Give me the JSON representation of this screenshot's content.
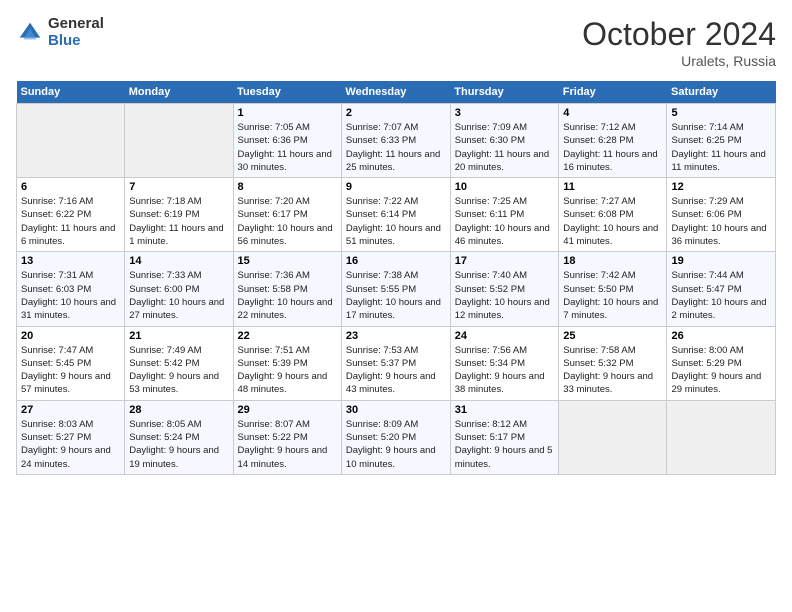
{
  "logo": {
    "general": "General",
    "blue": "Blue"
  },
  "title": "October 2024",
  "location": "Uralets, Russia",
  "days_of_week": [
    "Sunday",
    "Monday",
    "Tuesday",
    "Wednesday",
    "Thursday",
    "Friday",
    "Saturday"
  ],
  "weeks": [
    [
      {
        "day": "",
        "info": ""
      },
      {
        "day": "",
        "info": ""
      },
      {
        "day": "1",
        "info": "Sunrise: 7:05 AM\nSunset: 6:36 PM\nDaylight: 11 hours and 30 minutes."
      },
      {
        "day": "2",
        "info": "Sunrise: 7:07 AM\nSunset: 6:33 PM\nDaylight: 11 hours and 25 minutes."
      },
      {
        "day": "3",
        "info": "Sunrise: 7:09 AM\nSunset: 6:30 PM\nDaylight: 11 hours and 20 minutes."
      },
      {
        "day": "4",
        "info": "Sunrise: 7:12 AM\nSunset: 6:28 PM\nDaylight: 11 hours and 16 minutes."
      },
      {
        "day": "5",
        "info": "Sunrise: 7:14 AM\nSunset: 6:25 PM\nDaylight: 11 hours and 11 minutes."
      }
    ],
    [
      {
        "day": "6",
        "info": "Sunrise: 7:16 AM\nSunset: 6:22 PM\nDaylight: 11 hours and 6 minutes."
      },
      {
        "day": "7",
        "info": "Sunrise: 7:18 AM\nSunset: 6:19 PM\nDaylight: 11 hours and 1 minute."
      },
      {
        "day": "8",
        "info": "Sunrise: 7:20 AM\nSunset: 6:17 PM\nDaylight: 10 hours and 56 minutes."
      },
      {
        "day": "9",
        "info": "Sunrise: 7:22 AM\nSunset: 6:14 PM\nDaylight: 10 hours and 51 minutes."
      },
      {
        "day": "10",
        "info": "Sunrise: 7:25 AM\nSunset: 6:11 PM\nDaylight: 10 hours and 46 minutes."
      },
      {
        "day": "11",
        "info": "Sunrise: 7:27 AM\nSunset: 6:08 PM\nDaylight: 10 hours and 41 minutes."
      },
      {
        "day": "12",
        "info": "Sunrise: 7:29 AM\nSunset: 6:06 PM\nDaylight: 10 hours and 36 minutes."
      }
    ],
    [
      {
        "day": "13",
        "info": "Sunrise: 7:31 AM\nSunset: 6:03 PM\nDaylight: 10 hours and 31 minutes."
      },
      {
        "day": "14",
        "info": "Sunrise: 7:33 AM\nSunset: 6:00 PM\nDaylight: 10 hours and 27 minutes."
      },
      {
        "day": "15",
        "info": "Sunrise: 7:36 AM\nSunset: 5:58 PM\nDaylight: 10 hours and 22 minutes."
      },
      {
        "day": "16",
        "info": "Sunrise: 7:38 AM\nSunset: 5:55 PM\nDaylight: 10 hours and 17 minutes."
      },
      {
        "day": "17",
        "info": "Sunrise: 7:40 AM\nSunset: 5:52 PM\nDaylight: 10 hours and 12 minutes."
      },
      {
        "day": "18",
        "info": "Sunrise: 7:42 AM\nSunset: 5:50 PM\nDaylight: 10 hours and 7 minutes."
      },
      {
        "day": "19",
        "info": "Sunrise: 7:44 AM\nSunset: 5:47 PM\nDaylight: 10 hours and 2 minutes."
      }
    ],
    [
      {
        "day": "20",
        "info": "Sunrise: 7:47 AM\nSunset: 5:45 PM\nDaylight: 9 hours and 57 minutes."
      },
      {
        "day": "21",
        "info": "Sunrise: 7:49 AM\nSunset: 5:42 PM\nDaylight: 9 hours and 53 minutes."
      },
      {
        "day": "22",
        "info": "Sunrise: 7:51 AM\nSunset: 5:39 PM\nDaylight: 9 hours and 48 minutes."
      },
      {
        "day": "23",
        "info": "Sunrise: 7:53 AM\nSunset: 5:37 PM\nDaylight: 9 hours and 43 minutes."
      },
      {
        "day": "24",
        "info": "Sunrise: 7:56 AM\nSunset: 5:34 PM\nDaylight: 9 hours and 38 minutes."
      },
      {
        "day": "25",
        "info": "Sunrise: 7:58 AM\nSunset: 5:32 PM\nDaylight: 9 hours and 33 minutes."
      },
      {
        "day": "26",
        "info": "Sunrise: 8:00 AM\nSunset: 5:29 PM\nDaylight: 9 hours and 29 minutes."
      }
    ],
    [
      {
        "day": "27",
        "info": "Sunrise: 8:03 AM\nSunset: 5:27 PM\nDaylight: 9 hours and 24 minutes."
      },
      {
        "day": "28",
        "info": "Sunrise: 8:05 AM\nSunset: 5:24 PM\nDaylight: 9 hours and 19 minutes."
      },
      {
        "day": "29",
        "info": "Sunrise: 8:07 AM\nSunset: 5:22 PM\nDaylight: 9 hours and 14 minutes."
      },
      {
        "day": "30",
        "info": "Sunrise: 8:09 AM\nSunset: 5:20 PM\nDaylight: 9 hours and 10 minutes."
      },
      {
        "day": "31",
        "info": "Sunrise: 8:12 AM\nSunset: 5:17 PM\nDaylight: 9 hours and 5 minutes."
      },
      {
        "day": "",
        "info": ""
      },
      {
        "day": "",
        "info": ""
      }
    ]
  ]
}
